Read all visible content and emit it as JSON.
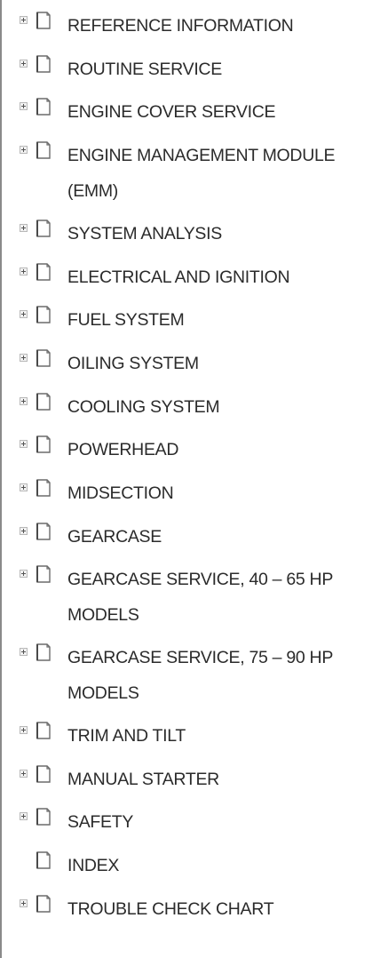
{
  "tree": {
    "items": [
      {
        "label": "REFERENCE INFORMATION",
        "expandable": true
      },
      {
        "label": "ROUTINE SERVICE",
        "expandable": true
      },
      {
        "label": "ENGINE COVER SERVICE",
        "expandable": true
      },
      {
        "label": "ENGINE MANAGEMENT MODULE (EMM)",
        "expandable": true
      },
      {
        "label": "SYSTEM ANALYSIS",
        "expandable": true
      },
      {
        "label": "ELECTRICAL AND IGNITION",
        "expandable": true
      },
      {
        "label": "FUEL SYSTEM",
        "expandable": true
      },
      {
        "label": "OILING SYSTEM",
        "expandable": true
      },
      {
        "label": "COOLING SYSTEM",
        "expandable": true
      },
      {
        "label": "POWERHEAD",
        "expandable": true
      },
      {
        "label": "MIDSECTION",
        "expandable": true
      },
      {
        "label": "GEARCASE",
        "expandable": true
      },
      {
        "label": "GEARCASE SERVICE, 40 – 65 HP MODELS",
        "expandable": true
      },
      {
        "label": "GEARCASE SERVICE, 75 – 90 HP MODELS",
        "expandable": true
      },
      {
        "label": "TRIM AND TILT",
        "expandable": true
      },
      {
        "label": "MANUAL STARTER",
        "expandable": true
      },
      {
        "label": "SAFETY",
        "expandable": true
      },
      {
        "label": "INDEX",
        "expandable": false
      },
      {
        "label": "TROUBLE CHECK CHART",
        "expandable": true
      }
    ]
  },
  "colors": {
    "text": "#2b2b2b",
    "icon_page": "#ffffff",
    "icon_outline": "#6b6b6b",
    "background": "#ffffff"
  },
  "icons": {
    "expander": "plus-box-icon",
    "item": "book-page-icon"
  }
}
